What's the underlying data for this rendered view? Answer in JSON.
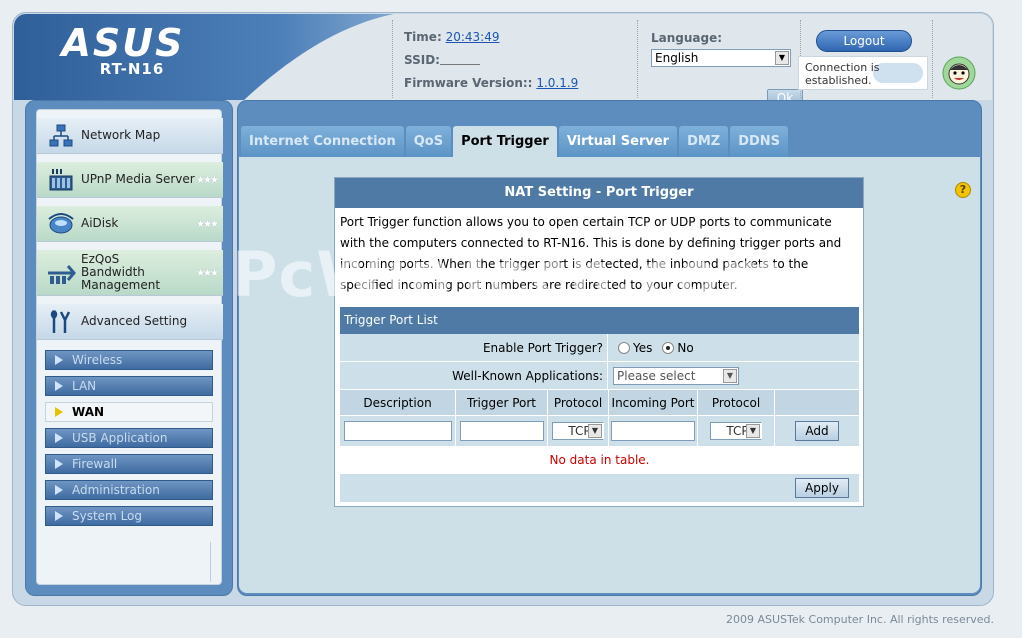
{
  "header": {
    "brand": "ASUS",
    "model": "RT-N16",
    "time_label": "Time:",
    "time_value": "20:43:49",
    "ssid_label": "SSID:",
    "firmware_label": "Firmware Version::",
    "firmware_value": "1.0.1.9",
    "language_label": "Language:",
    "language_value": "English",
    "ok_label": "Ok",
    "logout_label": "Logout",
    "connection_status": "Connection is established."
  },
  "sidebar": {
    "menu": [
      {
        "label": "Network Map",
        "icon": "network-map-icon"
      },
      {
        "label": "UPnP Media Server",
        "icon": "media-server-icon"
      },
      {
        "label": "AiDisk",
        "icon": "aidisk-icon"
      },
      {
        "label": "EzQoS Bandwidth Management",
        "icon": "ezqos-icon"
      },
      {
        "label": "Advanced Setting",
        "icon": "advanced-setting-icon"
      }
    ],
    "submenu": [
      {
        "label": "Wireless"
      },
      {
        "label": "LAN"
      },
      {
        "label": "WAN",
        "active": true
      },
      {
        "label": "USB Application"
      },
      {
        "label": "Firewall"
      },
      {
        "label": "Administration"
      },
      {
        "label": "System Log"
      }
    ]
  },
  "tabs": [
    {
      "label": "Internet Connection"
    },
    {
      "label": "QoS"
    },
    {
      "label": "Port Trigger",
      "active": true
    },
    {
      "label": "Virtual Server"
    },
    {
      "label": "DMZ"
    },
    {
      "label": "DDNS"
    }
  ],
  "panel": {
    "title": "NAT Setting - Port Trigger",
    "description": "Port Trigger function allows you to open certain TCP or UDP ports to communicate with the computers connected to RT-N16. This is done by defining trigger ports and incoming ports. When the trigger port is detected, the inbound packets to the specified incoming port numbers are redirected to your computer.",
    "table_title": "Trigger Port List",
    "enable_label": "Enable Port Trigger?",
    "yes_label": "Yes",
    "no_label": "No",
    "enable_value": "No",
    "wellknown_label": "Well-Known Applications:",
    "wellknown_value": "Please select",
    "columns": [
      "Description",
      "Trigger Port",
      "Protocol",
      "Incoming Port",
      "Protocol"
    ],
    "trigger_protocol": "TCP",
    "incoming_protocol": "TCP",
    "add_label": "Add",
    "empty_message": "No data in table.",
    "apply_label": "Apply"
  },
  "watermark": "PcWinTech.com",
  "footer": "2009 ASUSTek Computer Inc. All rights reserved."
}
